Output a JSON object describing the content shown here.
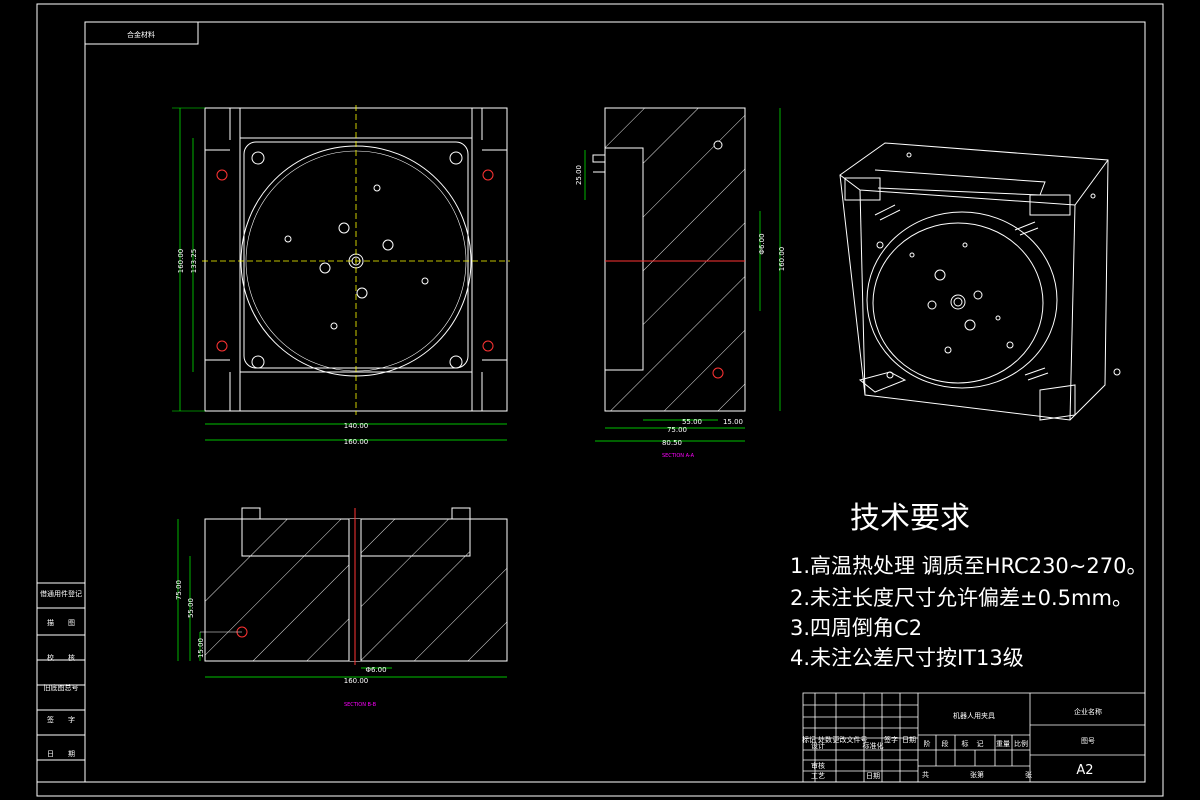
{
  "drawing": {
    "title_tab": "合金材料",
    "side_labels": [
      "借通用件登记",
      "描　　图",
      "校　　核",
      "旧底图总号",
      "签　　字",
      "日　　期"
    ],
    "front_view": {
      "dims": {
        "width_outer": "160.00",
        "width_inner": "140.00",
        "height_outer": "160.00",
        "height_inner": "133.25"
      }
    },
    "section_aa": {
      "label": "SECTION A-A",
      "dims": {
        "top_small": "25.00",
        "dia": "Φ6.00",
        "height": "160.00",
        "d1": "55.00",
        "d2": "15.00",
        "d3": "75.00",
        "d4": "80.50"
      }
    },
    "section_bb": {
      "label": "SECTION B-B",
      "dims": {
        "height_total": "75.00",
        "h2": "55.00",
        "h3": "15.00",
        "dia": "Φ6.00",
        "width": "160.00"
      }
    },
    "requirements": {
      "title": "技术要求",
      "items": [
        "1.高温热处理   调质至HRC230~270。",
        "2.未注长度尺寸允许偏差±0.5mm。",
        "3.四周倒角C2",
        "4.未注公差尺寸按IT13级"
      ]
    },
    "title_block": {
      "part_name": "机器人用夹具",
      "company": "企业名称",
      "material": "图号",
      "sheet_size": "A2",
      "row_labels": [
        "标记",
        "处数",
        "更改文件号",
        "签字",
        "日期"
      ],
      "design": "设计",
      "standard": "标准化",
      "process": "工艺",
      "check": "审核",
      "date": "日期",
      "stage_labels": [
        "阶",
        "段",
        "标",
        "记",
        "重量",
        "比例"
      ],
      "sheets": "共",
      "sheet_no": "张第",
      "page": "张"
    }
  }
}
